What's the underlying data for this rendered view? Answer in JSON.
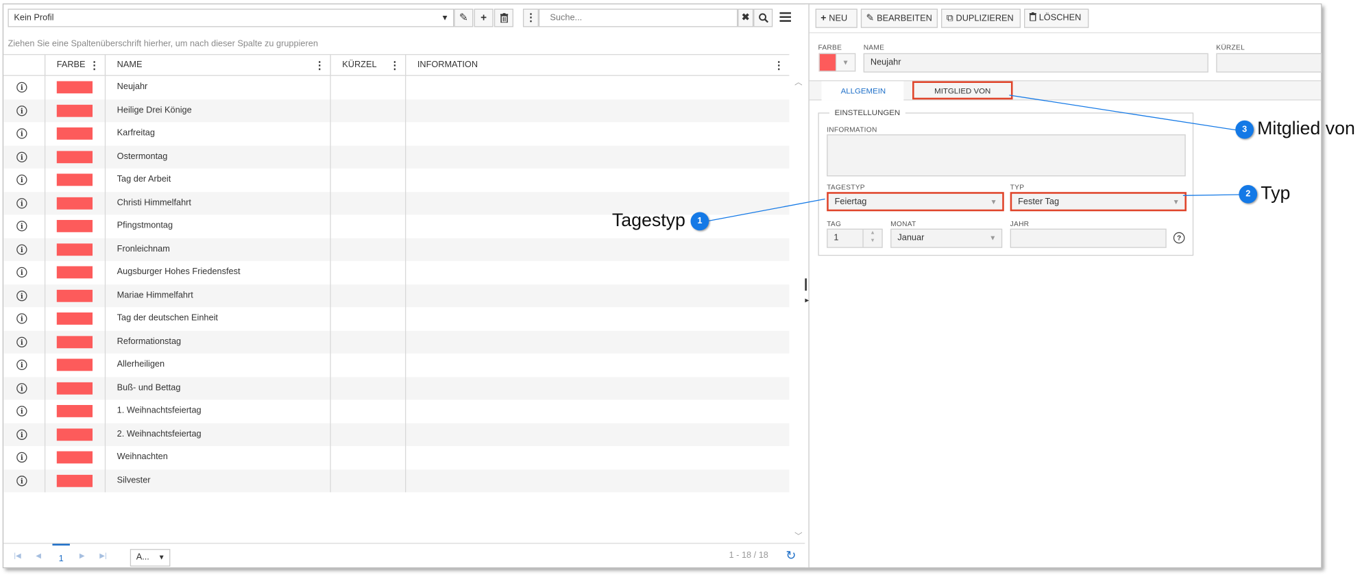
{
  "toolbar": {
    "profile_value": "Kein Profil",
    "search_placeholder": "Suche..."
  },
  "group_hint": "Ziehen Sie eine Spaltenüberschrift hierher, um nach dieser Spalte zu gruppieren",
  "grid": {
    "columns": [
      "FARBE",
      "NAME",
      "KÜRZEL",
      "INFORMATION"
    ],
    "row_color": "#fd5b5b",
    "rows": [
      "Neujahr",
      "Heilige Drei Könige",
      "Karfreitag",
      "Ostermontag",
      "Tag der Arbeit",
      "Christi Himmelfahrt",
      "Pfingstmontag",
      "Fronleichnam",
      "Augsburger Hohes Friedensfest",
      "Mariae Himmelfahrt",
      "Tag der deutschen Einheit",
      "Reformationstag",
      "Allerheiligen",
      "Buß- und Bettag",
      "1. Weihnachtsfeiertag",
      "2. Weihnachtsfeiertag",
      "Weihnachten",
      "Silvester"
    ]
  },
  "pager": {
    "current_page": "1",
    "page_size": "A...",
    "range": "1 - 18 / 18"
  },
  "actions": {
    "new": "NEU",
    "edit": "BEARBEITEN",
    "duplicate": "DUPLIZIEREN",
    "delete": "LÖSCHEN"
  },
  "detail": {
    "farbe_label": "FARBE",
    "name_label": "NAME",
    "name_value": "Neujahr",
    "kuerzel_label": "KÜRZEL",
    "kuerzel_value": "",
    "color": "#fd5b5b",
    "tabs": [
      "ALLGEMEIN",
      "MITGLIED VON"
    ],
    "settings_legend": "EINSTELLUNGEN",
    "information_label": "INFORMATION",
    "tagestyp_label": "TAGESTYP",
    "tagestyp_value": "Feiertag",
    "typ_label": "TYP",
    "typ_value": "Fester Tag",
    "tag_label": "TAG",
    "tag_value": "1",
    "monat_label": "MONAT",
    "monat_value": "Januar",
    "jahr_label": "JAHR",
    "jahr_value": ""
  },
  "callouts": [
    {
      "number": "1",
      "text": "Tagestyp"
    },
    {
      "number": "2",
      "text": "Typ"
    },
    {
      "number": "3",
      "text": "Mitglied von"
    }
  ],
  "colors": {
    "accent": "#1e6fc8",
    "highlight": "#e0442a",
    "badge": "#1479e6"
  }
}
